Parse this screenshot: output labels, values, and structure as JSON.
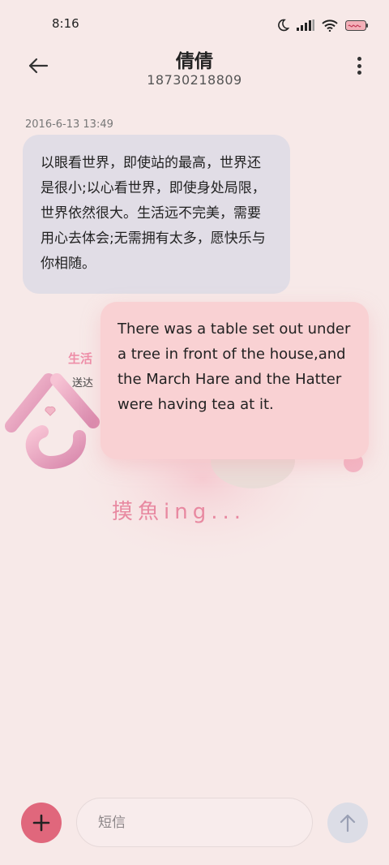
{
  "status_bar": {
    "time": "8:16"
  },
  "header": {
    "contact_name": "倩倩",
    "phone_number": "18730218809",
    "back_icon": "arrow-left-icon",
    "more_icon": "more-vertical-icon"
  },
  "conversation": {
    "timestamp": "2016-6-13 13:49",
    "messages": [
      {
        "direction": "incoming",
        "text": "以眼看世界，即使站的最高，世界还是很小;以心看世界，即使身处局限，世界依然很大。生活远不完美，需要用心去体会;无需拥有太多，愿快乐与你相随。"
      },
      {
        "direction": "outgoing",
        "text": "There was a table set out under a tree in front of the house,and the March Hare and the Hatter were having tea at it."
      }
    ]
  },
  "sticker": {
    "label_life": "生活",
    "label_send": "送达",
    "caption": "摸魚ing..."
  },
  "composer": {
    "placeholder": "短信",
    "add_icon": "plus-icon",
    "send_icon": "arrow-up-icon"
  },
  "colors": {
    "background": "#f7e9e8",
    "incoming_bubble": "#e1dde6",
    "outgoing_bubble": "#f9d1d3",
    "accent": "#e0677c"
  }
}
